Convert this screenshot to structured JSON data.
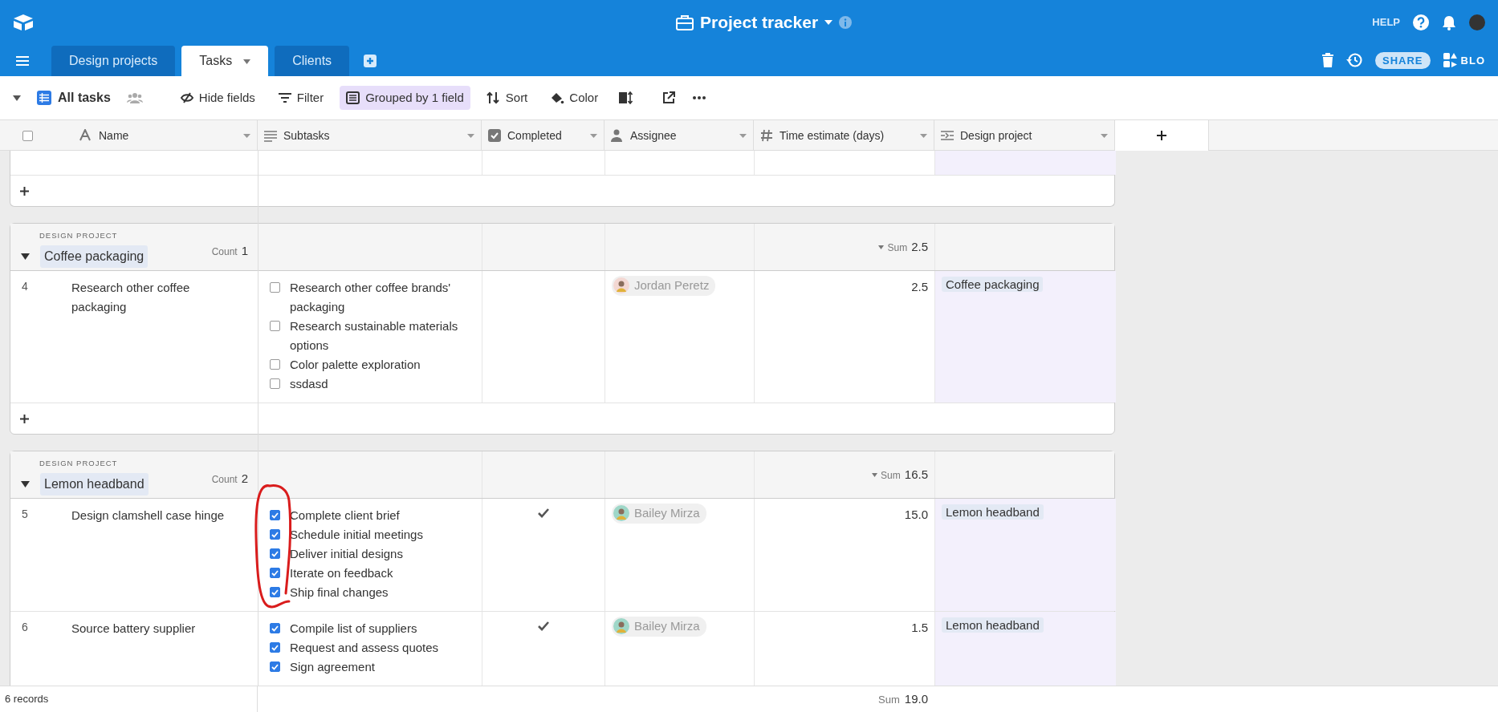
{
  "app": {
    "title": "Project tracker",
    "help": "HELP",
    "share": "SHARE",
    "blocks": "BLO"
  },
  "tables": [
    {
      "label": "Design projects",
      "selected": false
    },
    {
      "label": "Tasks",
      "selected": true
    },
    {
      "label": "Clients",
      "selected": false
    }
  ],
  "view": {
    "name": "All tasks"
  },
  "select_all": {
    "checked": false
  },
  "toolbar": [
    {
      "label": "Hide fields",
      "active": false
    },
    {
      "label": "Filter",
      "active": false
    },
    {
      "label": "Grouped by 1 field",
      "active": true
    },
    {
      "label": "Sort",
      "active": false
    },
    {
      "label": "Color",
      "active": false
    }
  ],
  "columns": [
    {
      "label": "Name"
    },
    {
      "label": "Subtasks"
    },
    {
      "label": "Completed"
    },
    {
      "label": "Assignee"
    },
    {
      "label": "Time estimate (days)"
    },
    {
      "label": "Design project"
    }
  ],
  "groups": [
    {
      "field": "DESIGN PROJECT",
      "name": "Coffee packaging",
      "count_label": "Count",
      "count": "1",
      "sum_label": "Sum",
      "sum": "2.5",
      "annotation": false,
      "records": [
        {
          "number": "4",
          "name": "Research other coffee packaging",
          "subtasks": [
            {
              "text": "Research other coffee brands' packaging",
              "checked": false
            },
            {
              "text": "Research sustainable materials options",
              "checked": false
            },
            {
              "text": "Color palette exploration",
              "checked": false
            },
            {
              "text": "ssdasd",
              "checked": false
            }
          ],
          "completed": false,
          "assignee": "Jordan Peretz",
          "estimate": "2.5",
          "project": "Coffee packaging"
        }
      ]
    },
    {
      "field": "DESIGN PROJECT",
      "name": "Lemon headband",
      "count_label": "Count",
      "count": "2",
      "sum_label": "Sum",
      "sum": "16.5",
      "annotation": true,
      "records": [
        {
          "number": "5",
          "name": "Design clamshell case hinge",
          "subtasks": [
            {
              "text": "Complete client brief",
              "checked": true
            },
            {
              "text": "Schedule initial meetings",
              "checked": true
            },
            {
              "text": "Deliver initial designs",
              "checked": true
            },
            {
              "text": "Iterate on feedback",
              "checked": true
            },
            {
              "text": "Ship final changes",
              "checked": true
            }
          ],
          "completed": true,
          "assignee": "Bailey Mirza",
          "estimate": "15.0",
          "project": "Lemon headband"
        },
        {
          "number": "6",
          "name": "Source battery supplier",
          "subtasks": [
            {
              "text": "Compile list of suppliers",
              "checked": true
            },
            {
              "text": "Request and assess quotes",
              "checked": true
            },
            {
              "text": "Sign agreement",
              "checked": true
            }
          ],
          "completed": true,
          "assignee": "Bailey Mirza",
          "estimate": "1.5",
          "project": "Lemon headband"
        }
      ]
    }
  ],
  "footer": {
    "records": "6 records",
    "sum_label": "Sum",
    "sum": "19.0"
  }
}
